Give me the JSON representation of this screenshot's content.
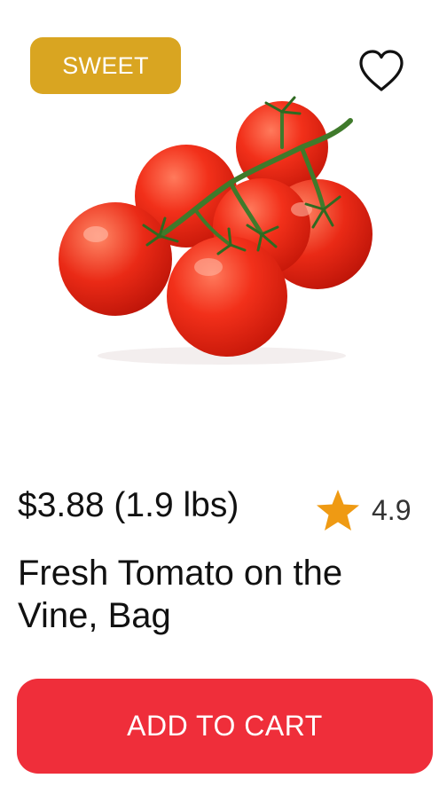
{
  "badge": {
    "label": "SWEET",
    "color": "#d9a521"
  },
  "favorite": {
    "icon": "heart-outline-icon"
  },
  "product": {
    "image_icon": "tomato-vine-image",
    "price": "$3.88 (1.9 lbs)",
    "rating": {
      "icon": "star-icon",
      "value": "4.9",
      "star_color": "#ef9a13"
    },
    "title": "Fresh Tomato on the Vine, Bag"
  },
  "cart": {
    "button_label": "ADD TO CART",
    "color": "#ef2e3a"
  }
}
